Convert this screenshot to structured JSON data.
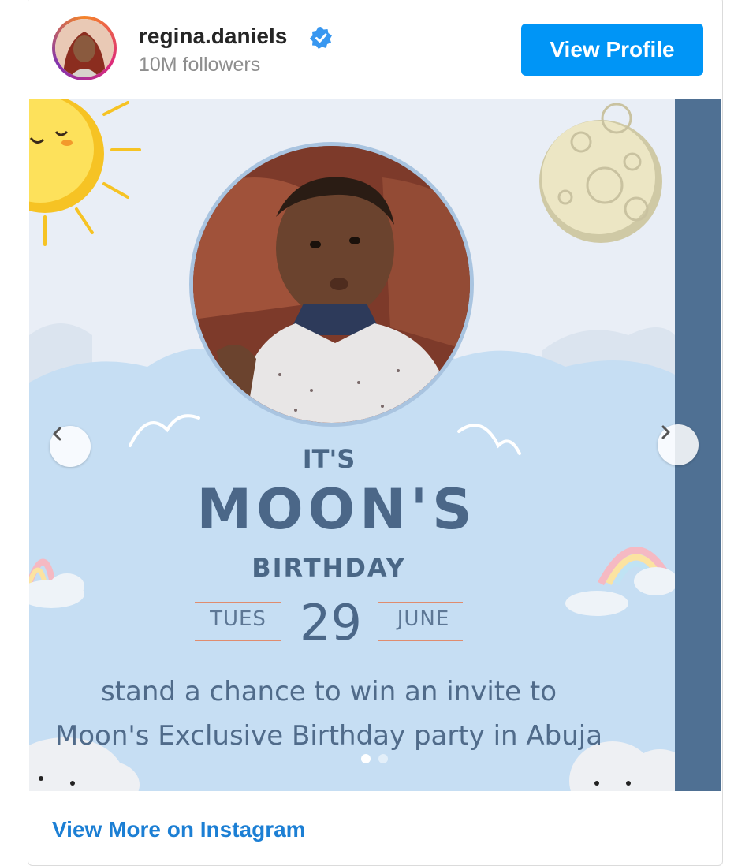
{
  "header": {
    "username": "regina.daniels",
    "followers": "10M followers",
    "view_profile_label": "View Profile"
  },
  "post": {
    "line1": "IT'S",
    "line2": "MOON'S",
    "line3": "BIRTHDAY",
    "day": "TUES",
    "date": "29",
    "month": "JUNE",
    "description_line1": "stand a chance to win an invite to",
    "description_line2": "Moon's Exclusive Birthday party in Abuja"
  },
  "carousel": {
    "prev_icon": "chevron-left-icon",
    "next_icon": "chevron-right-icon",
    "current_slide": 1,
    "total_slides": 2
  },
  "footer": {
    "view_more_label": "View More on Instagram"
  },
  "colors": {
    "accent": "#0095f6",
    "link": "#1c7fd4",
    "sky": "#e9eef6",
    "cloud": "#c5ddf2",
    "text_blue": "#4b6788",
    "next_slide": "#4f7093"
  }
}
